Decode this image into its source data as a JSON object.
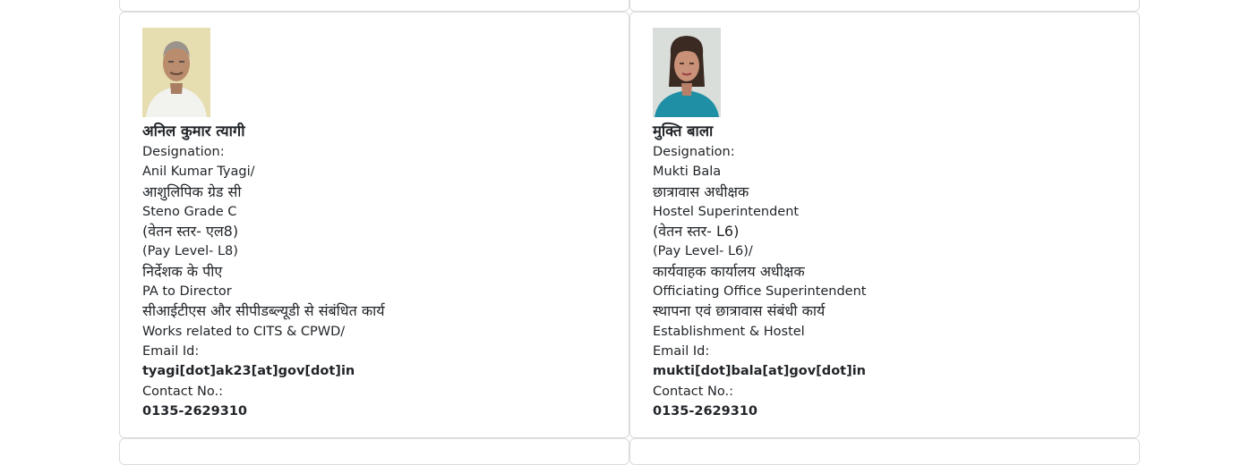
{
  "cards": [
    {
      "name_hindi": "अनिल कुमार त्यागी",
      "designation_label": "Designation:",
      "lines": [
        {
          "text": "Anil Kumar Tyagi/",
          "hindi": false
        },
        {
          "text": "आशुलिपिक ग्रेड सी",
          "hindi": true
        },
        {
          "text": "Steno Grade C",
          "hindi": false
        },
        {
          "text": "(वेतन स्तर- एल8)",
          "hindi": true
        },
        {
          "text": "(Pay Level- L8)",
          "hindi": false
        },
        {
          "text": "निर्देशक के पीए",
          "hindi": true
        },
        {
          "text": "PA to Director",
          "hindi": false
        },
        {
          "text": "सीआईटीएस और सीपीडब्ल्यूडी से संबंधित कार्य",
          "hindi": true
        },
        {
          "text": "Works related to CITS & CPWD/",
          "hindi": false
        }
      ],
      "email_label": "Email Id:",
      "email": "tyagi[dot]ak23[at]gov[dot]in",
      "contact_label": "Contact No.:",
      "contact": "0135-2629310",
      "colors": {
        "photo_bg": "#e6ddb0",
        "shirt": "#f2f2ef",
        "skin": "#b98c6e",
        "hair": "#9a948c"
      }
    },
    {
      "name_hindi": "मुक्ति बाला",
      "designation_label": "Designation:",
      "lines": [
        {
          "text": "Mukti Bala",
          "hindi": false
        },
        {
          "text": "छात्रावास अधीक्षक",
          "hindi": true
        },
        {
          "text": "Hostel Superintendent",
          "hindi": false
        },
        {
          "text": "(वेतन स्तर- L6)",
          "hindi": true
        },
        {
          "text": "(Pay Level- L6)/",
          "hindi": false
        },
        {
          "text": "कार्यवाहक कार्यालय अधीक्षक",
          "hindi": true
        },
        {
          "text": "Officiating Office Superintendent",
          "hindi": false
        },
        {
          "text": "स्थापना एवं छात्रावास संबंधी कार्य",
          "hindi": true
        },
        {
          "text": "Establishment & Hostel",
          "hindi": false
        }
      ],
      "email_label": "Email Id:",
      "email": "mukti[dot]bala[at]gov[dot]in",
      "contact_label": "Contact No.:",
      "contact": "0135-2629310",
      "colors": {
        "photo_bg": "#d9dedb",
        "shirt": "#1f8fa6",
        "skin": "#c99178",
        "hair": "#3a2a22"
      }
    }
  ]
}
